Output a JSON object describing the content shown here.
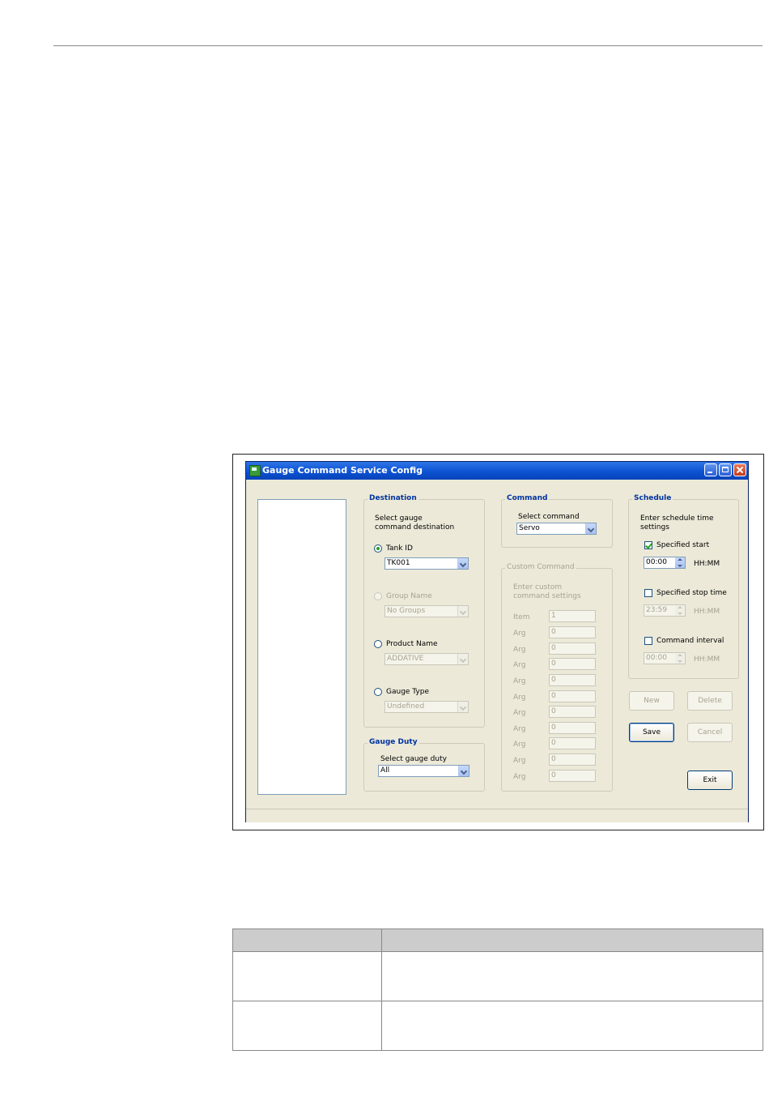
{
  "window": {
    "title": "Gauge Command Service Config"
  },
  "destination": {
    "legend": "Destination",
    "prompt_line1": "Select gauge",
    "prompt_line2": "command destination",
    "tank_id": {
      "label": "Tank ID",
      "value": "TK001",
      "checked": true
    },
    "group_name": {
      "label": "Group Name",
      "value": "No Groups",
      "disabled": true
    },
    "product_name": {
      "label": "Product Name",
      "value": "ADDATIVE"
    },
    "gauge_type": {
      "label": "Gauge Type",
      "value": "Undefined"
    }
  },
  "gauge_duty": {
    "legend": "Gauge Duty",
    "prompt": "Select gauge duty",
    "value": "All"
  },
  "command": {
    "legend": "Command",
    "prompt": "Select command",
    "value": "Servo"
  },
  "custom_command": {
    "legend": "Custom Command",
    "prompt_line1": "Enter custom",
    "prompt_line2": "command settings",
    "rows": [
      {
        "label": "Item",
        "value": "1"
      },
      {
        "label": "Arg",
        "value": "0"
      },
      {
        "label": "Arg",
        "value": "0"
      },
      {
        "label": "Arg",
        "value": "0"
      },
      {
        "label": "Arg",
        "value": "0"
      },
      {
        "label": "Arg",
        "value": "0"
      },
      {
        "label": "Arg",
        "value": "0"
      },
      {
        "label": "Arg",
        "value": "0"
      },
      {
        "label": "Arg",
        "value": "0"
      },
      {
        "label": "Arg",
        "value": "0"
      },
      {
        "label": "Arg",
        "value": "0"
      }
    ]
  },
  "schedule": {
    "legend": "Schedule",
    "prompt_line1": "Enter schedule time",
    "prompt_line2": "settings",
    "specified_start": {
      "label": "Specified start",
      "checked": true,
      "value": "00:00",
      "unit": "HH:MM"
    },
    "specified_stop": {
      "label": "Specified stop time",
      "checked": false,
      "value": "23:59",
      "unit": "HH:MM"
    },
    "command_interval": {
      "label": "Command interval",
      "checked": false,
      "value": "00:00",
      "unit": "HH:MM"
    }
  },
  "buttons": {
    "new": "New",
    "delete": "Delete",
    "save": "Save",
    "cancel": "Cancel",
    "exit": "Exit"
  }
}
